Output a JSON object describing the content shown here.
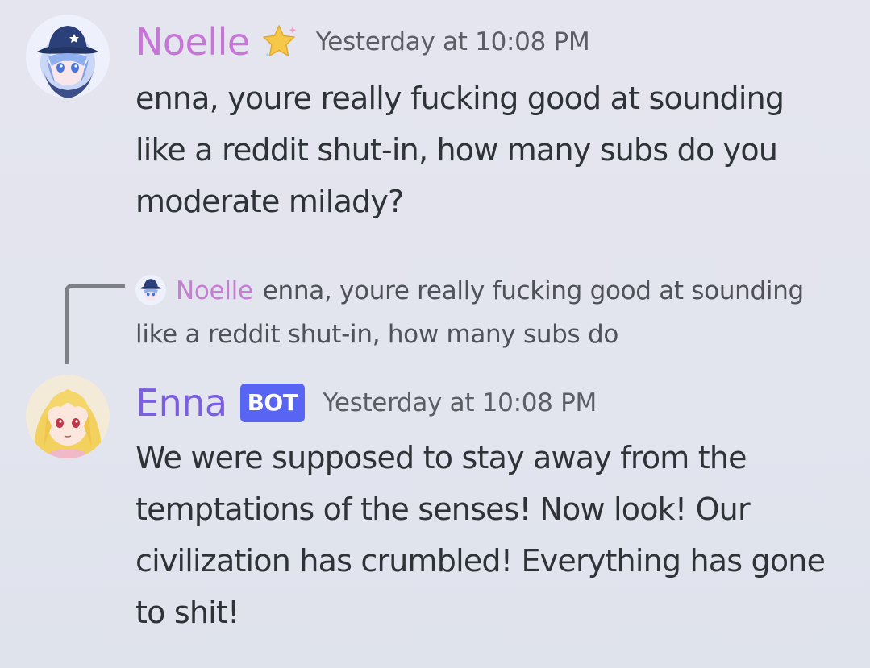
{
  "messages": [
    {
      "username": "Noelle",
      "username_color": "#c776d8",
      "timestamp": "Yesterday at 10:08 PM",
      "badge_icon": "star-icon",
      "avatar": "avatar-girl-blue-hat",
      "content": "enna, youre really fucking good at sounding like a reddit shut-in, how many subs do you moderate milady?"
    },
    {
      "username": "Enna",
      "username_color": "#7b5fe0",
      "timestamp": "Yesterday at 10:08 PM",
      "bot_label": "BOT",
      "bot_color": "#5865f2",
      "avatar": "avatar-girl-blonde",
      "reply": {
        "username": "Noelle",
        "content": "enna, youre really fucking good at sounding like a reddit shut-in, how many subs do"
      },
      "content": "We were supposed to stay away from the temptations of the senses! Now look! Our civilization has crumbled! Everything has gone to shit!"
    }
  ]
}
